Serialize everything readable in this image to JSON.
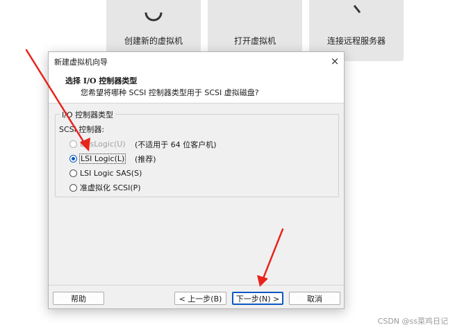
{
  "home_tiles": [
    {
      "label": "创建新的虚拟机"
    },
    {
      "label": "打开虚拟机"
    },
    {
      "label": "连接远程服务器"
    }
  ],
  "dialog": {
    "title": "新建虚拟机向导",
    "close_icon": "×",
    "header_title": "选择 I/O 控制器类型",
    "header_subtitle": "您希望将哪种 SCSI 控制器类型用于 SCSI 虚拟磁盘?",
    "group_title": "I/O 控制器类型",
    "scsi_label": "SCSI 控制器:",
    "options": [
      {
        "label": "BusLogic(U)",
        "note": "(不适用于 64 位客户机)",
        "checked": false,
        "disabled": true
      },
      {
        "label": "LSI Logic(L)",
        "note": "(推荐)",
        "checked": true,
        "disabled": false
      },
      {
        "label": "LSI Logic SAS(S)",
        "note": "",
        "checked": false,
        "disabled": false
      },
      {
        "label": "准虚拟化 SCSI(P)",
        "note": "",
        "checked": false,
        "disabled": false
      }
    ],
    "buttons": {
      "help": "帮助",
      "back": "< 上一步(B)",
      "next": "下一步(N) >",
      "cancel": "取消"
    }
  },
  "watermark": "CSDN @ss菜鸡日记",
  "colors": {
    "accent": "#0a58c2",
    "arrow": "#e8231b"
  }
}
